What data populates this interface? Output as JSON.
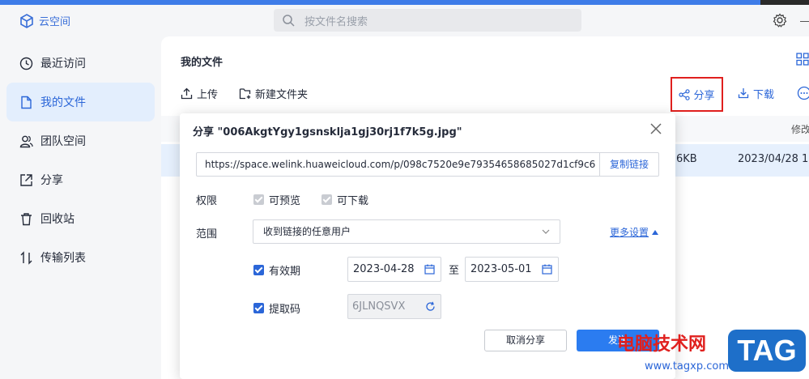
{
  "app": {
    "name": "云空间"
  },
  "search": {
    "placeholder": "按文件名搜索"
  },
  "sidebar": {
    "items": [
      {
        "label": "最近访问",
        "icon": "clock-icon"
      },
      {
        "label": "我的文件",
        "icon": "file-icon",
        "active": true
      },
      {
        "label": "团队空间",
        "icon": "team-icon"
      },
      {
        "label": "分享",
        "icon": "share-out-icon"
      },
      {
        "label": "回收站",
        "icon": "trash-icon"
      },
      {
        "label": "传输列表",
        "icon": "transfer-icon"
      }
    ]
  },
  "main": {
    "title": "我的文件",
    "toolbar": {
      "upload": "上传",
      "new_folder": "新建文件夹",
      "share": "分享",
      "download": "下载"
    },
    "columns": {
      "modified": "修改"
    },
    "row": {
      "size": "6KB",
      "date": "2023/04/28 1"
    }
  },
  "dialog": {
    "title": "分享 \"006AkgtYgy1gsnsklja1gj30rj1f7k5g.jpg\"",
    "link_url": "https://space.welink.huaweicloud.com/p/098c7520e9e79354658685027d1cf9c6",
    "copy_link": "复制链接",
    "permission_label": "权限",
    "can_preview": "可预览",
    "can_download": "可下载",
    "scope_label": "范围",
    "scope_value": "收到链接的任意用户",
    "more_settings": "更多设置",
    "validity_label": "有效期",
    "date_from": "2023-04-28",
    "date_sep": "至",
    "date_to": "2023-05-01",
    "code_label": "提取码",
    "code_value": "6JLNQSVX",
    "cancel": "取消分享",
    "send": "发送"
  },
  "watermark": {
    "text": "电脑技术网",
    "url": "www.tagxp.com",
    "tag": "TAG"
  },
  "colors": {
    "accent": "#2b66d8",
    "highlight_border": "#e0201e",
    "primary_button": "#2b7cf0"
  }
}
